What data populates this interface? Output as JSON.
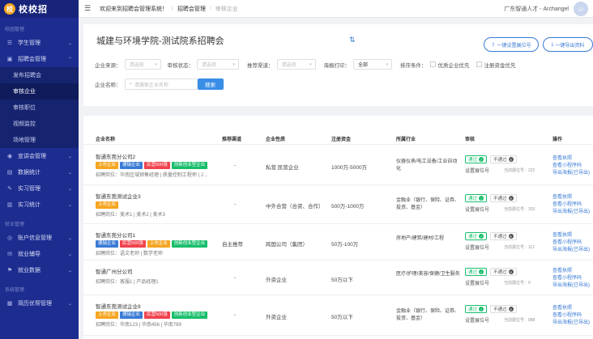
{
  "sidebar": {
    "logo_badge": "校",
    "logo_text": "校校招",
    "group1": "校园管理",
    "group2": "就业管理",
    "group3": "系统管理",
    "items": {
      "student": "学生管理",
      "recruit": "招聘会管理",
      "sub_publish": "发布招聘会",
      "sub_audit_co": "审核企业",
      "sub_audit_job": "审核职位",
      "sub_video": "视频监控",
      "sub_venue": "场地管理",
      "preach": "宣讲会管理",
      "stats": "数据统计",
      "practice": "实习管理",
      "practice_stats": "实习统计",
      "account": "账户信息管理",
      "guide": "就业辅导",
      "emp_data": "就业数据",
      "resume": "简历优帮管理"
    }
  },
  "topbar": {
    "welcome": "欢迎来到招聘会管理系统！",
    "crumb1": "招聘会管理",
    "crumb2": "审核企业",
    "user": "广东智通人才 - Archangel"
  },
  "filter": {
    "title": "城建与环境学院-测试院系招聘会",
    "btn_setpos": "一键设置展位号",
    "btn_export": "一键导出资料",
    "labels": {
      "source": "企业来源：",
      "audit": "审核状态：",
      "channel": "推荐渠道：",
      "print": "海报打印：",
      "sort": "排序条件：",
      "name": "企业名称："
    },
    "placeholder": "请选择",
    "print_value": "全部",
    "cb_prior": "优质企业优先",
    "cb_capital": "注册资金优先",
    "name_placeholder": "请搜索企业名称",
    "search": "搜索"
  },
  "table": {
    "headers": {
      "name": "企业名称",
      "channel": "推荐渠道",
      "nature": "企业性质",
      "capital": "注册资金",
      "industry": "所属行业",
      "audit": "审核",
      "op": "操作"
    },
    "rows": [
      {
        "name": "智通东莞分公司2",
        "tags": [
          [
            "上市企业",
            "or"
          ],
          [
            "德瑞企业",
            "bl"
          ],
          [
            "民营500强",
            "rd"
          ],
          [
            "创新创业型企业",
            "gr"
          ]
        ],
        "jobs": "招聘岗位：华南区域销售经理 | 质量控制工程师 | J...",
        "channel": "-",
        "nature": "私营 民营企业",
        "capital": "1000万-5000万",
        "industry": "仪器仪表/电工设备/工业自动化",
        "pass": "通过",
        "npass": "不通过",
        "setpos": "设置展位号",
        "curpos": "当前展位号：222",
        "ops": [
          "查看执照",
          "查看小程序码",
          "导出海报(已导出)"
        ]
      },
      {
        "name": "智通东莞测试企业3",
        "tags": [
          [
            "上市企业",
            "or"
          ]
        ],
        "jobs": "招聘岗位：美术1 | 美术2 | 美术3",
        "channel": "-",
        "nature": "中外合营（合资、合作）",
        "capital": "500万-1000万",
        "industry": "金融业（银行、保险、证券、投资、基金）",
        "pass": "通过",
        "npass": "不通过",
        "setpos": "设置展位号",
        "curpos": "当前展位号：333",
        "ops": [
          "查看执照",
          "查看小程序码",
          "导出海报(已导出)"
        ]
      },
      {
        "name": "智通东莞分公司1",
        "tags": [
          [
            "德瑞企业",
            "bl"
          ],
          [
            "民营500强",
            "rd"
          ],
          [
            "上市企业",
            "or"
          ],
          [
            "创新创业型企业",
            "gr"
          ]
        ],
        "jobs": "招聘岗位：语文老师 | 数学老师",
        "channel": "自主推荐",
        "nature": "跨国公司（集团）",
        "capital": "50万-100万",
        "industry": "房地产/建筑/建材/工程",
        "pass": "通过",
        "npass": "不通过",
        "setpos": "设置展位号",
        "curpos": "当前展位号：111",
        "ops": [
          "查看执照",
          "查看小程序码",
          "导出海报(已导出)"
        ]
      },
      {
        "name": "智通广州分公司",
        "tags": [],
        "jobs": "招聘岗位：客服1 | 产品经理1",
        "channel": "-",
        "nature": "外资企业",
        "capital": "50万以下",
        "industry": "医疗/护理/美容/保健/卫生服务",
        "pass": "通过",
        "npass": "不通过",
        "setpos": "设置展位号",
        "curpos": "当前展位号：0",
        "ops": [
          "查看执照",
          "查看小程序码",
          "导出海报(已导出)"
        ]
      },
      {
        "name": "智通东莞测试企业8",
        "tags": [
          [
            "上市企业",
            "or"
          ],
          [
            "德瑞企业",
            "bl"
          ],
          [
            "民营500强",
            "rd"
          ],
          [
            "创新创业型企业",
            "gr"
          ]
        ],
        "jobs": "招聘岗位：华南123 | 华南456 | 华南789",
        "channel": "-",
        "nature": "外资企业",
        "capital": "50万以下",
        "industry": "金融业（银行、保险、证券、投资、基金）",
        "pass": "通过",
        "npass": "不通过",
        "setpos": "设置展位号",
        "curpos": "当前展位号：888",
        "ops": [
          "查看执照",
          "查看小程序码",
          "导出海报(已导出)"
        ]
      }
    ]
  }
}
